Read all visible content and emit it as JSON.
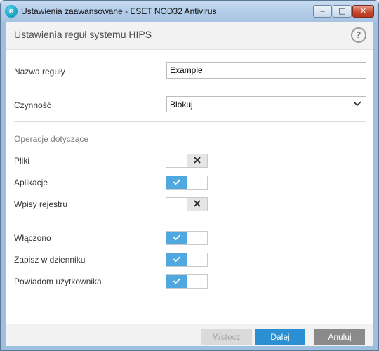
{
  "window": {
    "title": "Ustawienia zaawansowane - ESET NOD32 Antivirus",
    "icon": "eset-logo-icon",
    "controls": {
      "minimize": "‒",
      "maximize": "□",
      "close": "✕"
    }
  },
  "header": {
    "title": "Ustawienia reguł systemu HIPS",
    "help_glyph": "?"
  },
  "form": {
    "rule_name": {
      "label": "Nazwa reguły",
      "value": "Example"
    },
    "action": {
      "label": "Czynność",
      "value": "Blokuj"
    },
    "operations_heading": "Operacje dotyczące",
    "operations": [
      {
        "label": "Pliki",
        "enabled": false
      },
      {
        "label": "Aplikacje",
        "enabled": true
      },
      {
        "label": "Wpisy rejestru",
        "enabled": false
      }
    ],
    "options": [
      {
        "label": "Włączono",
        "enabled": true
      },
      {
        "label": "Zapisz w dzienniku",
        "enabled": true
      },
      {
        "label": "Powiadom użytkownika",
        "enabled": true
      }
    ]
  },
  "footer": {
    "back_label": "Wstecz",
    "next_label": "Dalej",
    "cancel_label": "Anuluj"
  },
  "colors": {
    "accent": "#2b8fd3",
    "toggle_on": "#4fa8df",
    "button_disabled": "#dadada",
    "button_cancel": "#8a8a8a"
  }
}
